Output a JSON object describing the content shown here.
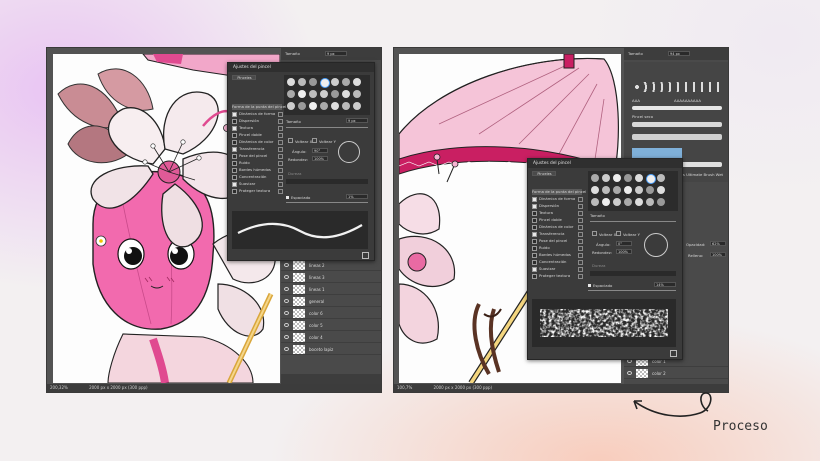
{
  "left_window": {
    "zoom_label": "200,32%",
    "doc_info": "2000 px x 2000 px (300 ppp)",
    "top_bar": {
      "size_label": "Tamaño",
      "size_value": "9 px"
    },
    "dialog": {
      "title": "Ajustes del pincel",
      "presets_button": "Pinceles",
      "options": [
        {
          "label": "Forma de la punta del pincel",
          "checked": false
        },
        {
          "label": "Dinámica de forma",
          "checked": true
        },
        {
          "label": "Dispersión",
          "checked": false
        },
        {
          "label": "Textura",
          "checked": true
        },
        {
          "label": "Pincel doble",
          "checked": false
        },
        {
          "label": "Dinámica de color",
          "checked": false
        },
        {
          "label": "Transferencia",
          "checked": true
        },
        {
          "label": "Pose del pincel",
          "checked": false
        },
        {
          "label": "Ruido",
          "checked": false
        },
        {
          "label": "Bordes húmedos",
          "checked": false
        },
        {
          "label": "Concentración",
          "checked": false
        },
        {
          "label": "Suavizar",
          "checked": true
        },
        {
          "label": "Proteger textura",
          "checked": false
        }
      ],
      "size_label": "Tamaño",
      "size_value": "9 px",
      "flip_x": "Voltear X",
      "flip_y": "Voltear Y",
      "angle_label": "Ángulo:",
      "angle_value": "90°",
      "roundness_label": "Redondez:",
      "roundness_value": "100%",
      "hardness_label": "Dureza",
      "spacing_label": "Espaciado",
      "spacing_value": "1%"
    },
    "layers": [
      "lineas 2",
      "lineas 3",
      "lineas 1",
      "general",
      "color 6",
      "color 5",
      "color 4",
      "boceto lapiz"
    ]
  },
  "right_window": {
    "zoom_label": "100,7%",
    "doc_info": "2000 px x 2000 px (300 ppp)",
    "top_bar": {
      "size_label": "Tamaño",
      "size_value": "94 px"
    },
    "brush_list": [
      "AAA",
      "AAAAAAAAAA",
      "Pincel seco",
      "Kyle's Ultimate Brush Wet"
    ],
    "dialog": {
      "title": "Ajustes del pincel",
      "presets_button": "Pinceles",
      "options": [
        {
          "label": "Forma de la punta del pincel",
          "checked": false
        },
        {
          "label": "Dinámica de forma",
          "checked": true
        },
        {
          "label": "Dispersión",
          "checked": true
        },
        {
          "label": "Textura",
          "checked": false
        },
        {
          "label": "Pincel doble",
          "checked": false
        },
        {
          "label": "Dinámica de color",
          "checked": false
        },
        {
          "label": "Transferencia",
          "checked": true
        },
        {
          "label": "Pose del pincel",
          "checked": false
        },
        {
          "label": "Ruido",
          "checked": false
        },
        {
          "label": "Bordes húmedos",
          "checked": false
        },
        {
          "label": "Concentración",
          "checked": false
        },
        {
          "label": "Suavizar",
          "checked": true
        },
        {
          "label": "Proteger textura",
          "checked": false
        }
      ],
      "size_label": "Tamaño",
      "flip_x": "Voltear X",
      "flip_y": "Voltear Y",
      "angle_label": "Ángulo:",
      "angle_value": "0°",
      "roundness_label": "Redondez:",
      "roundness_value": "100%",
      "hardness_label": "Dureza",
      "spacing_label": "Espaciado",
      "spacing_value": "14%"
    },
    "opacity_label": "Opacidad:",
    "opacity_value": "62%",
    "fill_label": "Relleno:",
    "fill_value": "100%",
    "layers": [
      "color 1",
      "color 2"
    ]
  },
  "annotation": {
    "label": "Proceso"
  },
  "colors": {
    "accent_pink": "#f06fb0",
    "ps_dark": "#535353",
    "dialog": "#3b3b3b"
  }
}
